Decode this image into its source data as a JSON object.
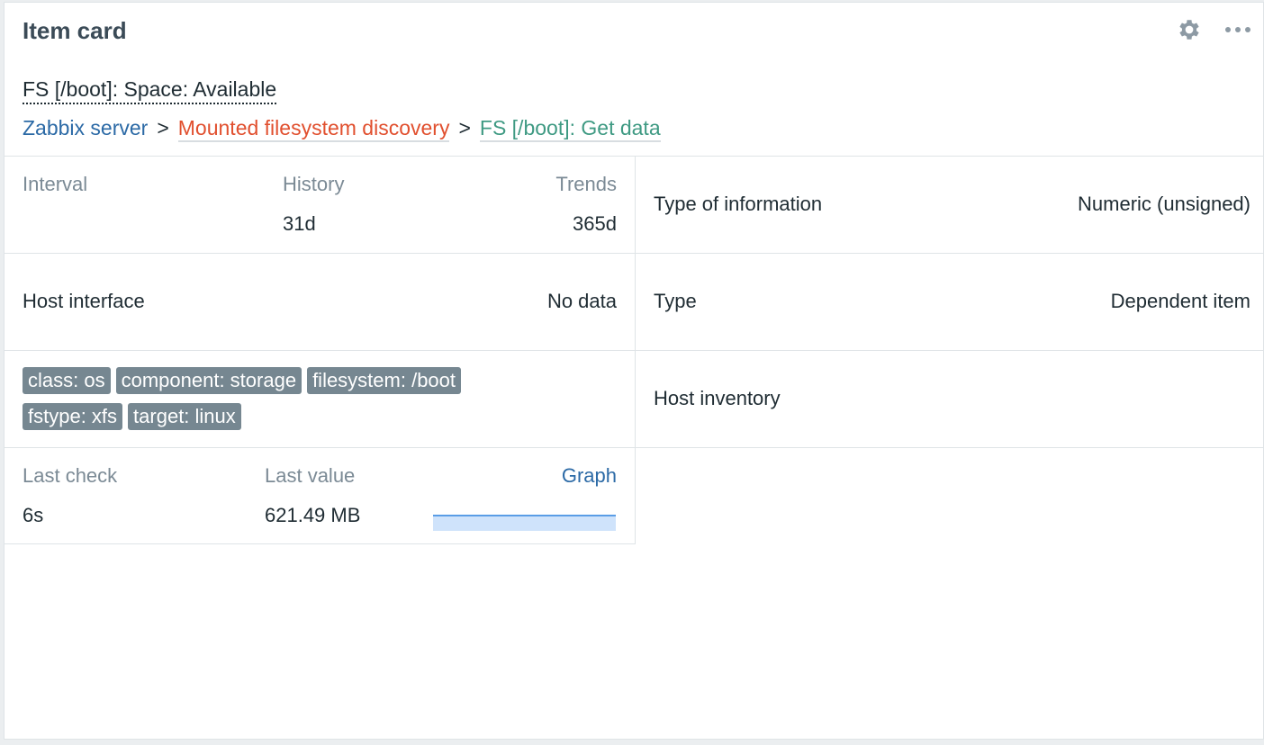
{
  "widget": {
    "title": "Item card"
  },
  "item": {
    "name": "FS [/boot]: Space: Available"
  },
  "breadcrumb": {
    "host": "Zabbix server",
    "separator": ">",
    "discovery_rule": "Mounted filesystem discovery",
    "master_item": "FS [/boot]: Get data"
  },
  "storage": {
    "interval_label": "Interval",
    "interval_value": "",
    "history_label": "History",
    "history_value": "31d",
    "trends_label": "Trends",
    "trends_value": "365d"
  },
  "type_of_information": {
    "label": "Type of information",
    "value": "Numeric (unsigned)"
  },
  "host_interface": {
    "label": "Host interface",
    "value": "No data"
  },
  "type": {
    "label": "Type",
    "value": "Dependent item"
  },
  "tags": [
    "class: os",
    "component: storage",
    "filesystem: /boot",
    "fstype: xfs",
    "target: linux"
  ],
  "host_inventory": {
    "label": "Host inventory"
  },
  "latest": {
    "last_check_label": "Last check",
    "last_check_value": "6s",
    "last_value_label": "Last value",
    "last_value_value": "621.49 MB",
    "graph_label": "Graph"
  },
  "colors": {
    "host_link": "#2c6aa6",
    "discovery_rule": "#e1502f",
    "master_item": "#3f9a83",
    "tag_bg": "#768791",
    "sparkline_fill": "#cfe3fb",
    "sparkline_line": "#5a9de6"
  },
  "icons": {
    "settings": "gear-icon",
    "menu": "more-horizontal-icon"
  }
}
